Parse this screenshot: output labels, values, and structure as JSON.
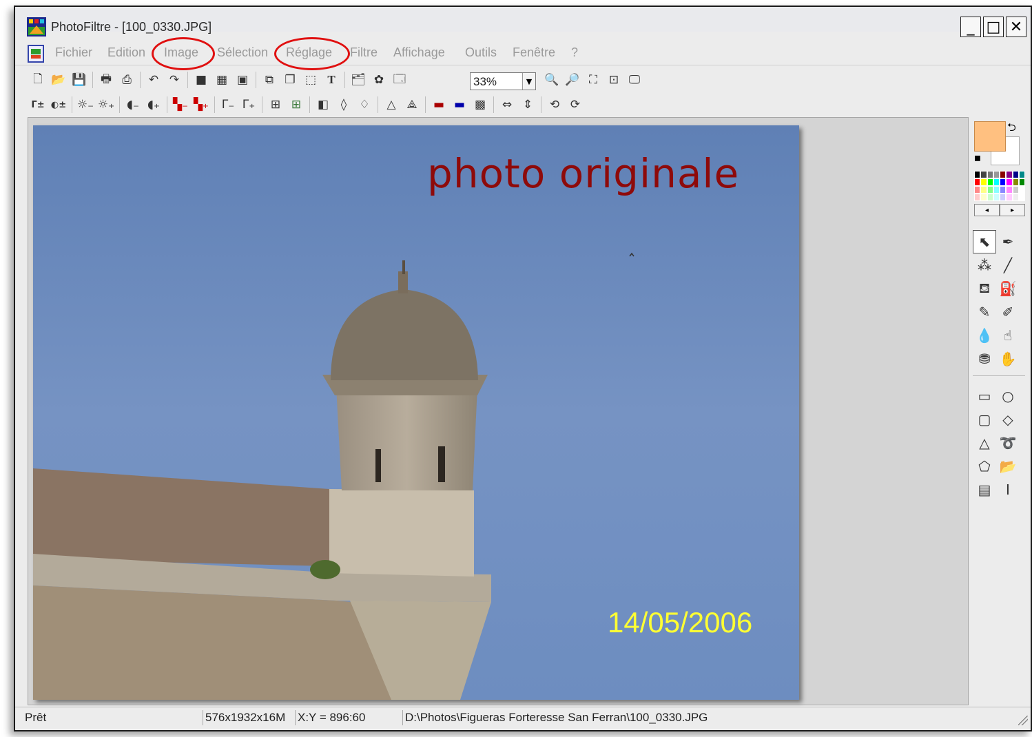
{
  "window": {
    "title": "PhotoFiltre - [100_0330.JPG]",
    "controls": {
      "minimize": "_",
      "maximize": "□",
      "close": "✕",
      "restore": "🗗"
    }
  },
  "menu": {
    "items": [
      "Fichier",
      "Edition",
      "Image",
      "Sélection",
      "Réglage",
      "Filtre",
      "Affichage",
      "Outils",
      "Fenêtre",
      "?"
    ],
    "highlighted": [
      "Image",
      "Réglage"
    ]
  },
  "toolbar": {
    "zoom": "33%"
  },
  "canvas": {
    "overlay_title": "photo  originale",
    "overlay_date": "14/05/2006"
  },
  "palette": {
    "foreground_color": "#ffc080",
    "background_color": "#ffffff",
    "scroll_left": "◂",
    "scroll_right": "▸"
  },
  "statusbar": {
    "state": "Prêt",
    "image_info": "576x1932x16M",
    "coords": "X:Y = 896:60",
    "path": "D:\\Photos\\Figueras Forteresse San Ferran\\100_0330.JPG"
  },
  "colors": {
    "accent_circle": "#e01010",
    "title_overlay": "#8e0a0a",
    "date_overlay": "#ffff33",
    "sky": "#6f8fbf"
  }
}
